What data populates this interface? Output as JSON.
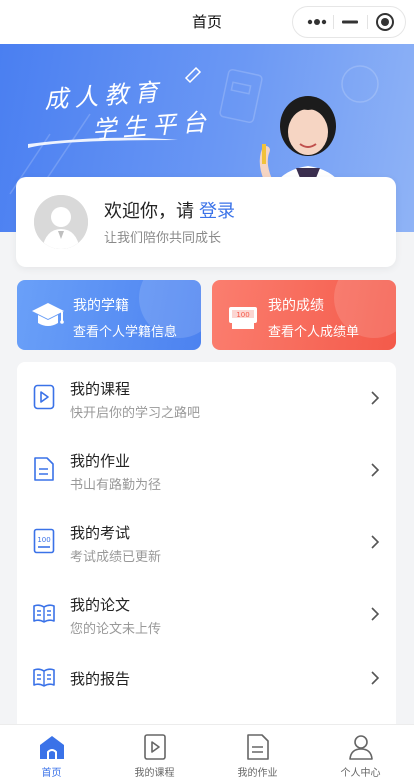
{
  "header": {
    "title": "首页",
    "capsule": {
      "more_icon": "more-dots-icon",
      "minimize_icon": "minimize-icon",
      "close_icon": "target-close-icon"
    }
  },
  "banner": {
    "title_line1": "成人教育",
    "title_line2": "学生平台",
    "colors": {
      "start": "#4a7ff1",
      "end": "#8fb3f6"
    }
  },
  "profile": {
    "welcome": "欢迎你，请",
    "login_link": "登录",
    "subtitle": "让我们陪你共同成长",
    "avatar_icon": "default-avatar-icon"
  },
  "quick_cards": [
    {
      "title": "我的学籍",
      "subtitle": "查看个人学籍信息",
      "icon": "graduation-cap-icon",
      "color": "#4c82f0"
    },
    {
      "title": "我的成绩",
      "subtitle": "查看个人成绩单",
      "icon": "score-report-icon",
      "score_text": "100",
      "color": "#f45a4a"
    }
  ],
  "menu": [
    {
      "title": "我的课程",
      "subtitle": "快开启你的学习之路吧",
      "icon": "course-play-icon"
    },
    {
      "title": "我的作业",
      "subtitle": "书山有路勤为径",
      "icon": "homework-doc-icon"
    },
    {
      "title": "我的考试",
      "subtitle": "考试成绩已更新",
      "icon": "exam-score-icon",
      "score_text": "100"
    },
    {
      "title": "我的论文",
      "subtitle": "您的论文未上传",
      "icon": "thesis-book-icon"
    },
    {
      "title": "我的报告",
      "subtitle": "",
      "icon": "report-book-icon"
    }
  ],
  "tabbar": {
    "active_color": "#3a72e8",
    "items": [
      {
        "label": "首页",
        "icon": "home-icon",
        "active": true
      },
      {
        "label": "我的课程",
        "icon": "course-tab-icon",
        "active": false
      },
      {
        "label": "我的作业",
        "icon": "homework-tab-icon",
        "active": false
      },
      {
        "label": "个人中心",
        "icon": "user-tab-icon",
        "active": false
      }
    ]
  }
}
